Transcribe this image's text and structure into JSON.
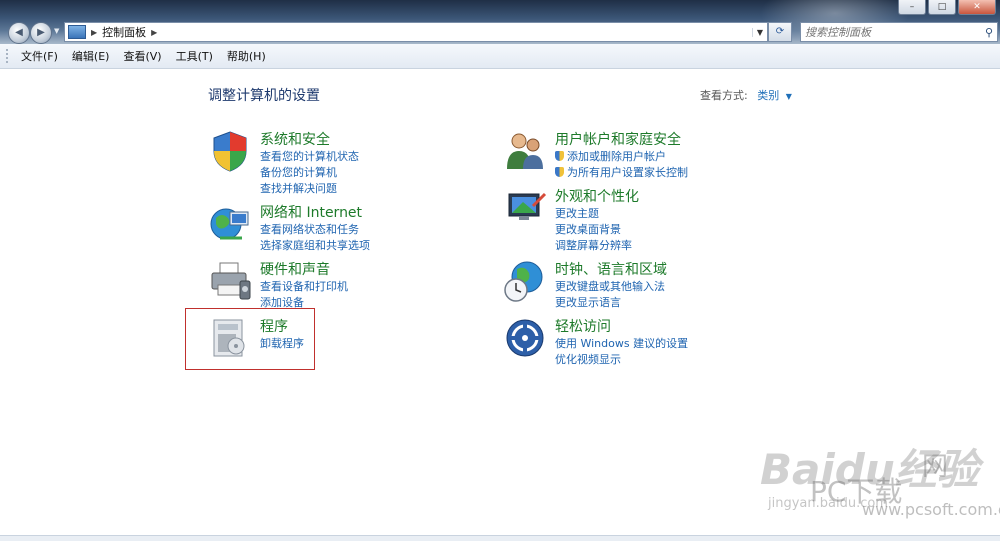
{
  "address_bar": {
    "breadcrumb": "控制面板",
    "search_placeholder": "搜索控制面板"
  },
  "window_buttons": [
    "–",
    "□",
    "✕"
  ],
  "menu": [
    "文件(F)",
    "编辑(E)",
    "查看(V)",
    "工具(T)",
    "帮助(H)"
  ],
  "page_title": "调整计算机的设置",
  "view_by": {
    "label": "查看方式:",
    "value": "类别"
  },
  "categories": [
    {
      "title": "系统和安全",
      "icon": "shield-icon",
      "links": [
        "查看您的计算机状态",
        "备份您的计算机",
        "查找并解决问题"
      ]
    },
    {
      "title": "网络和 Internet",
      "icon": "network-globe-icon",
      "links": [
        "查看网络状态和任务",
        "选择家庭组和共享选项"
      ]
    },
    {
      "title": "硬件和声音",
      "icon": "printer-icon",
      "links": [
        "查看设备和打印机",
        "添加设备"
      ]
    },
    {
      "title": "程序",
      "icon": "programs-icon",
      "links": [
        "卸载程序"
      ]
    },
    {
      "title": "用户帐户和家庭安全",
      "icon": "users-icon",
      "links": [
        "添加或删除用户帐户",
        "为所有用户设置家长控制"
      ]
    },
    {
      "title": "外观和个性化",
      "icon": "monitor-icon",
      "links": [
        "更改主题",
        "更改桌面背景",
        "调整屏幕分辨率"
      ]
    },
    {
      "title": "时钟、语言和区域",
      "icon": "clock-globe-icon",
      "links": [
        "更改键盘或其他输入法",
        "更改显示语言"
      ]
    },
    {
      "title": "轻松访问",
      "icon": "ease-of-access-icon",
      "links": [
        "使用 Windows 建议的设置",
        "优化视频显示"
      ]
    }
  ],
  "watermark": {
    "baidu": "Baidu经验",
    "jingyan": "jingyan.baidu.com",
    "pc": "PC下载",
    "wang": "网",
    "url": "www.pcsoft.com.cn"
  },
  "colors": {
    "category_title": "#1d7a2a",
    "link": "#1f64b0",
    "page_title": "#1e3a6e",
    "highlight_box": "#c0302d"
  }
}
